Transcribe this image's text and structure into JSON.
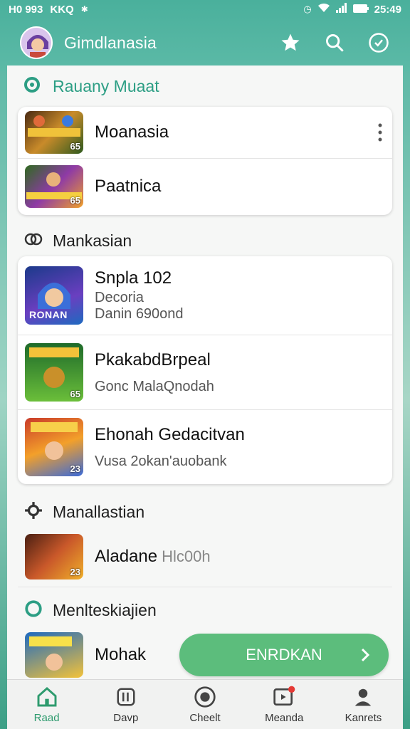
{
  "status": {
    "left": "H0 993",
    "code": "KKQ",
    "time": "25:49"
  },
  "app": {
    "title": "Gimdlanasia"
  },
  "sections": [
    {
      "label": "Rauany  Muaat"
    },
    {
      "label": "Mankasian"
    },
    {
      "label": "Manallastian"
    },
    {
      "label": "Menlteskiajien"
    }
  ],
  "card1": [
    {
      "title": "Moanasia",
      "badge": "65"
    },
    {
      "title": "Paatnica",
      "badge": "65"
    }
  ],
  "card2": [
    {
      "title": "Snpla 102",
      "sub1": "Decoria",
      "sub2": "Danin 690ond",
      "badge": "RONAN"
    },
    {
      "title": "PkakabdBrpeal",
      "sub1": "Gonc MalaQnodah",
      "badge": "65"
    },
    {
      "title": "Ehonah Gedacitvan",
      "sub1": "Vusa 2okan'auobank",
      "badge": "23"
    }
  ],
  "row6": {
    "title": "Aladane",
    "sub": "Hlc00h",
    "badge": "23"
  },
  "row7": {
    "title": "Mohak"
  },
  "install": {
    "label": "ENRDKAN"
  },
  "nav": [
    {
      "label": "Raad",
      "active": true
    },
    {
      "label": "Davp"
    },
    {
      "label": "Cheelt"
    },
    {
      "label": "Meanda"
    },
    {
      "label": "Kanrets"
    }
  ],
  "colors": {
    "accent": "#4aae98",
    "button": "#5cbd7c",
    "active_nav": "#2e9b6e"
  }
}
